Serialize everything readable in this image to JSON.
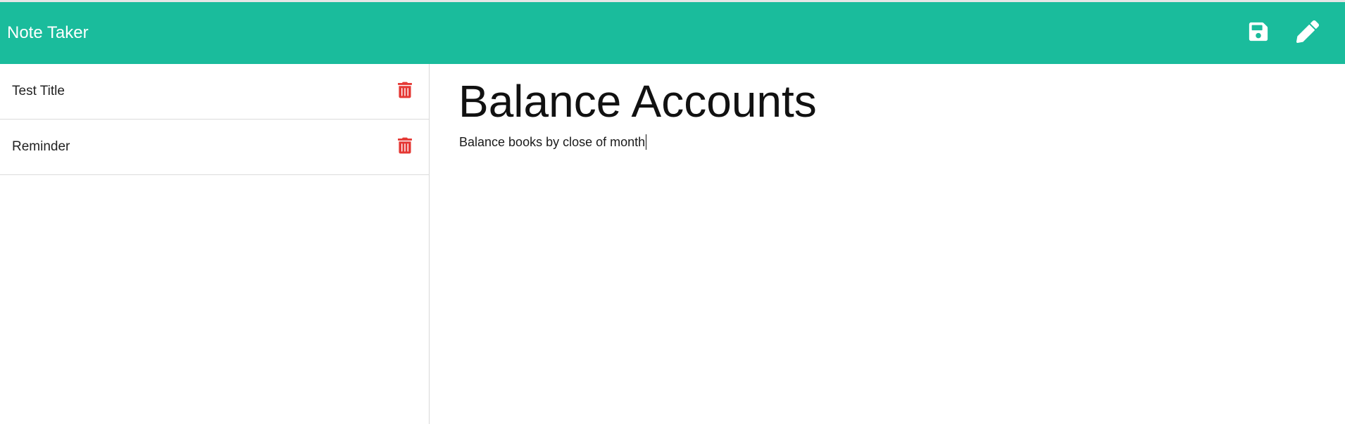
{
  "app": {
    "title": "Note Taker",
    "accent_color": "#1abc9c",
    "delete_color": "#e53935"
  },
  "toolbar": {
    "save_icon": "save-icon",
    "edit_icon": "pencil-icon"
  },
  "notes": [
    {
      "title": "Test Title",
      "icon": "trash-icon"
    },
    {
      "title": "Reminder",
      "icon": "trash-icon"
    }
  ],
  "active_note": {
    "title": "Balance Accounts",
    "text": "Balance books by close of month"
  }
}
